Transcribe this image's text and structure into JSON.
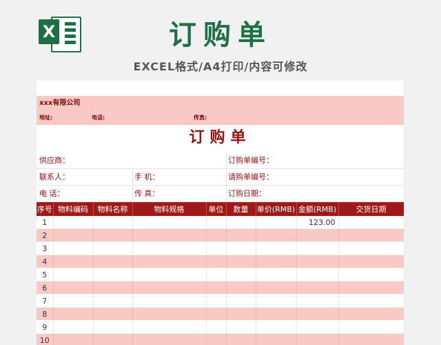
{
  "banner": {
    "logo_letter": "X",
    "title": "订购单",
    "subtitle": "EXCEL格式/A4打印/内容可修改"
  },
  "colors": {
    "excel_green": "#1d7044",
    "header_red": "#a01818",
    "stripe_pink": "#f8c9c5",
    "text_red": "#9a1212"
  },
  "sheet": {
    "company": "xxx有限公司",
    "address_label": "地址:",
    "phone_label": "电话:",
    "fax_label": "传真:",
    "form_title": "订购单",
    "info": {
      "supplier": "供应商：",
      "order_no": "订购单编号：",
      "contact": "联系人：",
      "mobile": "手    机：",
      "request_no": "请购单编号：",
      "tel": "电    话：",
      "fax": "传    真：",
      "order_date": "订购日期："
    },
    "columns": [
      "序号",
      "物料编码",
      "物料名称",
      "物料规格",
      "单位",
      "数量",
      "单价(RMB)",
      "金额(RMB)",
      "交货日期"
    ],
    "rows": [
      {
        "no": "1",
        "amount": "123.00"
      },
      {
        "no": "2",
        "amount": ""
      },
      {
        "no": "3",
        "amount": ""
      },
      {
        "no": "4",
        "amount": ""
      },
      {
        "no": "5",
        "amount": ""
      },
      {
        "no": "6",
        "amount": ""
      },
      {
        "no": "7",
        "amount": ""
      },
      {
        "no": "8",
        "amount": ""
      },
      {
        "no": "9",
        "amount": ""
      },
      {
        "no": "10",
        "amount": ""
      }
    ]
  }
}
